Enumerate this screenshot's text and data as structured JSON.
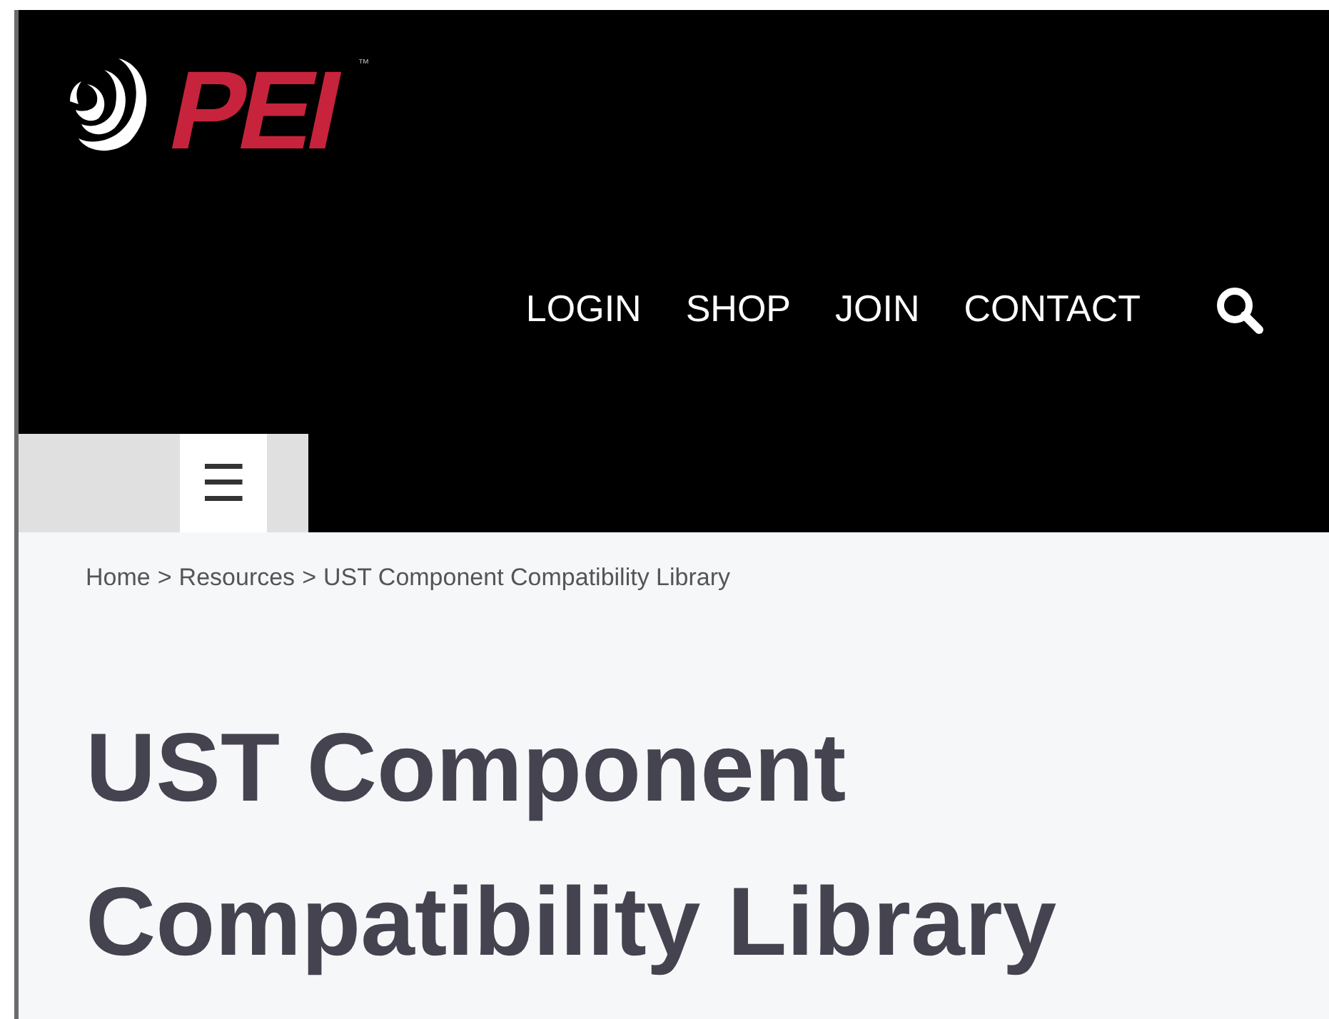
{
  "logo": {
    "text": "PEI",
    "trademark": "™"
  },
  "nav": [
    {
      "label": "LOGIN"
    },
    {
      "label": "SHOP"
    },
    {
      "label": "JOIN"
    },
    {
      "label": "CONTACT"
    }
  ],
  "menu_button": {
    "icon": "☰"
  },
  "breadcrumb": [
    {
      "label": "Home"
    },
    {
      "label": "Resources"
    },
    {
      "label": "UST Component Compatibility Library"
    }
  ],
  "breadcrumb_separator": ">",
  "title": "UST Component Compatibility Library"
}
